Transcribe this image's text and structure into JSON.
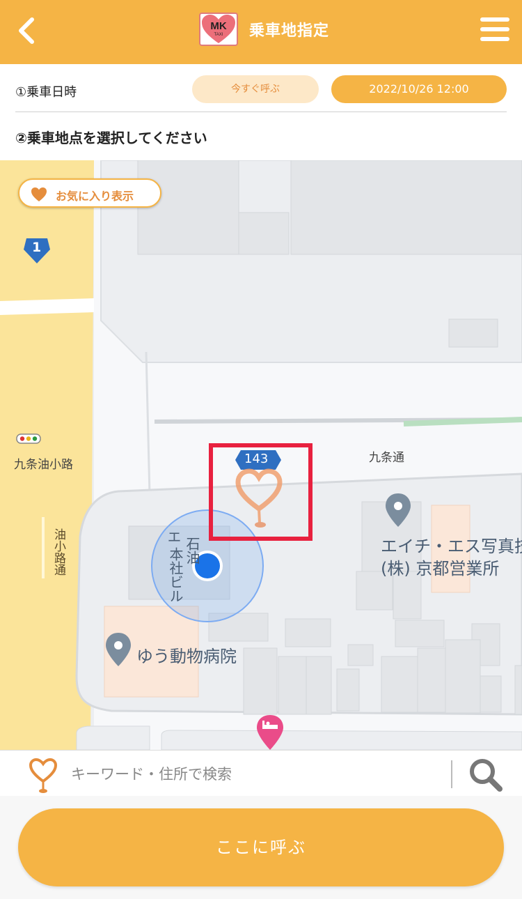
{
  "header": {
    "title": "乗車地指定",
    "logo_text": "MK",
    "logo_sub": "TAXI",
    "back_icon": "chevron-left-icon",
    "menu_icon": "hamburger-menu-icon"
  },
  "ride": {
    "datetime_label": "①乗車日時",
    "now_button": "今すぐ呼ぶ",
    "datetime_value": "2022/10/26 12:00",
    "location_label": "②乗車地点を選択してください"
  },
  "map": {
    "favorites_toggle": "お気に入り表示",
    "route_badge_1": "1",
    "route_badge_143": "143",
    "street_kujo_aburakoji": "九条油小路",
    "street_aburakoji": "油小路通",
    "street_kujo": "九条通",
    "building_label_1": "エ",
    "building_label_2": "石油",
    "building_label_3": "本社ビル",
    "poi_photo_1": "エイチ・エス写真技",
    "poi_photo_2": "(株) 京都営業所",
    "poi_vet": "ゆう動物病院"
  },
  "search": {
    "placeholder": "キーワード・住所で検索",
    "search_icon": "magnifier-icon"
  },
  "call_button": "ここに呼ぶ",
  "colors": {
    "brand_orange": "#f5b445",
    "accent_orange": "#e58d3c",
    "location_blue": "#1a73e8",
    "highlight_red": "#e8213f"
  }
}
